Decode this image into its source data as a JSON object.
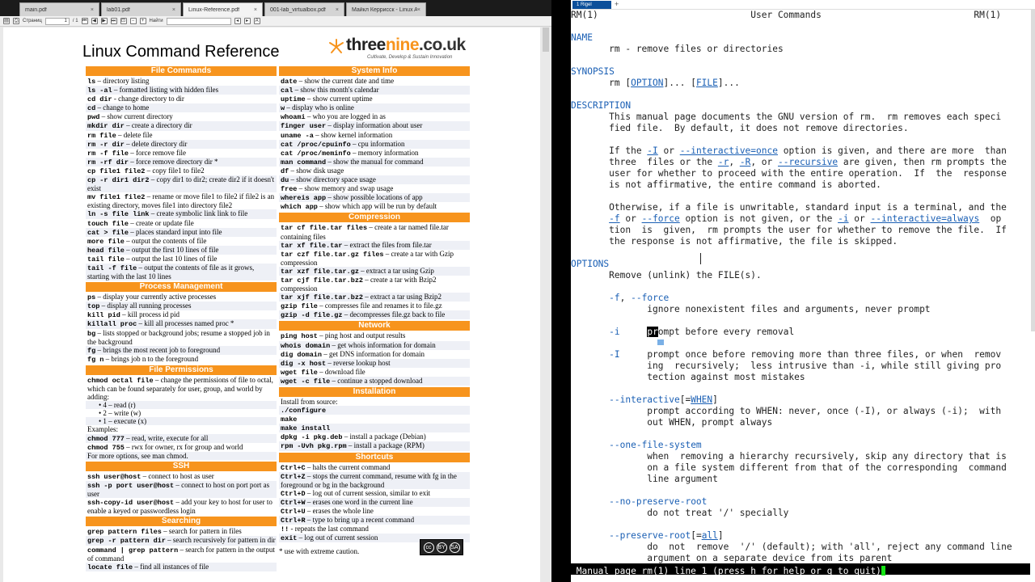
{
  "pdf_viewer": {
    "tabs": [
      {
        "label": "main.pdf",
        "active": false
      },
      {
        "label": "lab01.pdf",
        "active": false
      },
      {
        "label": "Linux-Reference.pdf",
        "active": true
      },
      {
        "label": "001-lab_virtualbox.pdf",
        "active": false
      },
      {
        "label": "Майкл Керрисск - Linux API. И...",
        "active": false
      }
    ],
    "toolbar": {
      "page_label": "Страниц",
      "page_value": "1",
      "page_total": "/ 1",
      "search_label": "Найти"
    }
  },
  "document": {
    "title": "Linux Command Reference",
    "logo": {
      "three": "three",
      "nine": "nine",
      "domain": ".co.uk",
      "tagline": "Cultivate, Develop & Sustain Innovation"
    },
    "footnote": "* use with extreme caution.",
    "cc_badge": [
      "cc",
      "BY",
      "SA"
    ],
    "left_column": [
      {
        "h": "File Commands"
      },
      {
        "c": "ls",
        "t": " – directory listing"
      },
      {
        "c": "ls -al",
        "t": " – formatted listing with hidden files"
      },
      {
        "c": "cd dir",
        "t": " - change directory to dir"
      },
      {
        "c": "cd",
        "t": " – change to home"
      },
      {
        "c": "pwd",
        "t": " – show current directory"
      },
      {
        "c": "mkdir dir",
        "t": " – create a directory dir"
      },
      {
        "c": "rm file",
        "t": " – delete file"
      },
      {
        "c": "rm -r dir",
        "t": " – delete directory dir"
      },
      {
        "c": "rm -f file",
        "t": " – force remove file"
      },
      {
        "c": "rm -rf dir",
        "t": " – force remove directory dir *"
      },
      {
        "c": "cp file1 file2",
        "t": " – copy file1 to file2"
      },
      {
        "c": "cp -r dir1 dir2",
        "t": " – copy dir1 to dir2; create dir2 if it doesn't exist"
      },
      {
        "c": "mv file1 file2",
        "t": " – rename or move file1 to file2 if file2 is an existing directory, moves file1 into directory file2"
      },
      {
        "c": "ln -s file link",
        "t": " – create symbolic link link to file"
      },
      {
        "c": "touch file",
        "t": " – create or update file"
      },
      {
        "c": "cat > file",
        "t": " – places standard input into file"
      },
      {
        "c": "more file",
        "t": " – output the contents of file"
      },
      {
        "c": "head file",
        "t": " – output the first 10 lines of file"
      },
      {
        "c": "tail file",
        "t": " – output the last 10 lines of file"
      },
      {
        "c": "tail -f file",
        "t": " – output the contents of file as it grows, starting with the last 10 lines"
      },
      {
        "h": "Process Management"
      },
      {
        "c": "ps",
        "t": " – display your currently active processes"
      },
      {
        "c": "top",
        "t": " – display all running processes"
      },
      {
        "c": "kill pid",
        "t": " – kill process id pid"
      },
      {
        "c": "killall proc",
        "t": " – kill all processes named proc *"
      },
      {
        "c": "bg",
        "t": " – lists stopped or background jobs; resume a stopped job in the background"
      },
      {
        "c": "fg",
        "t": " – brings the most recent job to foreground"
      },
      {
        "c": "fg n",
        "t": " – brings job n to the foreground"
      },
      {
        "h": "File Permissions"
      },
      {
        "c": "chmod octal file",
        "t": " – change the permissions of file to octal, which can be found separately for user, group, and world by adding:"
      },
      {
        "b": "4 – read (r)"
      },
      {
        "b": "2 – write (w)"
      },
      {
        "b": "1 – execute (x)"
      },
      {
        "c": "",
        "t": "Examples:"
      },
      {
        "c": "chmod 777",
        "t": " – read, write, execute for all"
      },
      {
        "c": "chmod 755",
        "t": " – rwx for owner, rx for group and world"
      },
      {
        "c": "",
        "t": "For more options, see man chmod."
      },
      {
        "h": "SSH"
      },
      {
        "c": "ssh user@host",
        "t": " – connect to host as user"
      },
      {
        "c": "ssh -p port user@host",
        "t": " – connect to host on port port as user"
      },
      {
        "c": "ssh-copy-id user@host",
        "t": " – add your key to host for user to enable a keyed or passwordless login"
      },
      {
        "h": "Searching"
      },
      {
        "c": "grep pattern files",
        "t": " – search for pattern in files"
      },
      {
        "c": "grep -r pattern dir",
        "t": " – search recursively for pattern in dir"
      },
      {
        "c": "command | grep pattern",
        "t": " – search for pattern in the output of command"
      },
      {
        "c": "locate file",
        "t": " – find all instances of file"
      }
    ],
    "right_column": [
      {
        "h": "System Info"
      },
      {
        "c": "date",
        "t": " – show the current date and time"
      },
      {
        "c": "cal",
        "t": " – show this month's calendar"
      },
      {
        "c": "uptime",
        "t": " – show current uptime"
      },
      {
        "c": "w",
        "t": " – display who is online"
      },
      {
        "c": "whoami",
        "t": " – who you are logged in as"
      },
      {
        "c": "finger user",
        "t": " – display information about user"
      },
      {
        "c": "uname -a",
        "t": " – show kernel information"
      },
      {
        "c": "cat /proc/cpuinfo",
        "t": " – cpu information"
      },
      {
        "c": "cat /proc/meminfo",
        "t": " – memory information"
      },
      {
        "c": "man command",
        "t": " – show the manual for command"
      },
      {
        "c": "df",
        "t": " – show disk usage"
      },
      {
        "c": "du",
        "t": " – show directory space usage"
      },
      {
        "c": "free",
        "t": " – show memory and swap usage"
      },
      {
        "c": "whereis app",
        "t": " – show possible locations of app"
      },
      {
        "c": "which app",
        "t": " – show which app will be run by default"
      },
      {
        "h": "Compression"
      },
      {
        "c": "tar cf file.tar files",
        "t": " – create a tar named file.tar containing files"
      },
      {
        "c": "tar xf file.tar",
        "t": " – extract the files from file.tar"
      },
      {
        "c": "tar czf file.tar.gz files",
        "t": " – create a tar with Gzip compression"
      },
      {
        "c": "tar xzf file.tar.gz",
        "t": " – extract a tar using Gzip"
      },
      {
        "c": "tar cjf file.tar.bz2",
        "t": " – create a tar with Bzip2 compression"
      },
      {
        "c": "tar xjf file.tar.bz2",
        "t": " – extract a tar using Bzip2"
      },
      {
        "c": "gzip file",
        "t": " – compresses file and renames it to file.gz"
      },
      {
        "c": "gzip -d file.gz",
        "t": " – decompresses file.gz back to file"
      },
      {
        "h": "Network"
      },
      {
        "c": "ping host",
        "t": " – ping host and output results"
      },
      {
        "c": "whois domain",
        "t": " – get whois information for domain"
      },
      {
        "c": "dig domain",
        "t": " – get DNS information for domain"
      },
      {
        "c": "dig -x host",
        "t": " – reverse lookup host"
      },
      {
        "c": "wget file",
        "t": " – download file"
      },
      {
        "c": "wget -c file",
        "t": " – continue a stopped download"
      },
      {
        "h": "Installation"
      },
      {
        "c": "",
        "t": "Install from source:"
      },
      {
        "c": "./configure",
        "t": ""
      },
      {
        "c": "make",
        "t": ""
      },
      {
        "c": "make install",
        "t": ""
      },
      {
        "c": "dpkg -i pkg.deb",
        "t": " – install a package (Debian)"
      },
      {
        "c": "rpm -Uvh pkg.rpm",
        "t": " – install a package (RPM)"
      },
      {
        "h": "Shortcuts"
      },
      {
        "c": "Ctrl+C",
        "t": " – halts the current command"
      },
      {
        "c": "Ctrl+Z",
        "t": " – stops the current command, resume with fg in the foreground or bg in the background"
      },
      {
        "c": "Ctrl+D",
        "t": " – log out of current session, similar to exit"
      },
      {
        "c": "Ctrl+W",
        "t": " – erases one word in the current line"
      },
      {
        "c": "Ctrl+U",
        "t": " – erases the whole line"
      },
      {
        "c": "Ctrl+R",
        "t": " – type to bring up a recent command"
      },
      {
        "c": "!!",
        "t": " - repeats the last command"
      },
      {
        "c": "exit",
        "t": " – log out of current session"
      }
    ]
  },
  "terminal": {
    "tab_label": "1 Rigel",
    "plus": "+",
    "lines": [
      {
        "html": "RM(1)                            User Commands                            RM(1)"
      },
      {
        "html": ""
      },
      {
        "html": "<span class=\"bl\">NAME</span>"
      },
      {
        "html": "       rm - remove files or directories"
      },
      {
        "html": ""
      },
      {
        "html": "<span class=\"bl\">SYNOPSIS</span>"
      },
      {
        "html": "       rm [<span class=\"blue\">OPTION</span>]... [<span class=\"blue\">FILE</span>]..."
      },
      {
        "html": ""
      },
      {
        "html": "<span class=\"bl\">DESCRIPTION</span>"
      },
      {
        "html": "       This manual page documents the GNU version of rm.  rm removes each speci"
      },
      {
        "html": "       fied file.  By default, it does not remove directories."
      },
      {
        "html": ""
      },
      {
        "html": "       If the <span class=\"blue\">-I</span> or <span class=\"blue\">--interactive=once</span> option is given, and there are more  than"
      },
      {
        "html": "       three  files or the <span class=\"blue\">-r</span>, <span class=\"blue\">-R</span>, or <span class=\"blue\">--recursive</span> are given, then rm prompts the"
      },
      {
        "html": "       user for whether to proceed with the entire operation.  If  the  response"
      },
      {
        "html": "       is not affirmative, the entire command is aborted."
      },
      {
        "html": ""
      },
      {
        "html": "       Otherwise, if a file is unwritable, standard input is a terminal, and the"
      },
      {
        "html": "       <span class=\"blue\">-f</span> or <span class=\"blue\">--force</span> option is not given, or the <span class=\"blue\">-i</span> or <span class=\"blue\">--interactive=always</span>  op"
      },
      {
        "html": "       tion  is  given,  rm prompts the user for whether to remove the file.  If"
      },
      {
        "html": "       the response is not affirmative, the file is skipped."
      },
      {
        "html": ""
      },
      {
        "html": "<span class=\"bl\">OPTIONS</span>"
      },
      {
        "html": "       Remove (unlink) the FILE(s)."
      },
      {
        "html": ""
      },
      {
        "html": "       <span class=\"bl\">-f</span>, <span class=\"bl\">--force</span>"
      },
      {
        "html": "              ignore nonexistent files and arguments, never prompt"
      },
      {
        "html": ""
      },
      {
        "html": "       <span class=\"bl\">-i</span>     <span class=\"cur\">pr</span>ompt before every removal"
      },
      {
        "html": ""
      },
      {
        "html": "       <span class=\"bl\">-I</span>     prompt once before removing more than three files, or when  remov"
      },
      {
        "html": "              ing  recursively;  less intrusive than -i, while still giving pro"
      },
      {
        "html": "              tection against most mistakes"
      },
      {
        "html": ""
      },
      {
        "html": "       <span class=\"bl\">--interactive</span>[=<span class=\"blue\">WHEN</span>]"
      },
      {
        "html": "              prompt according to WHEN: never, once (-I), or always (-i);  with"
      },
      {
        "html": "              out WHEN, prompt always"
      },
      {
        "html": ""
      },
      {
        "html": "       <span class=\"bl\">--one-file-system</span>"
      },
      {
        "html": "              when  removing a hierarchy recursively, skip any directory that is"
      },
      {
        "html": "              on a file system different from that of the corresponding  command"
      },
      {
        "html": "              line argument"
      },
      {
        "html": ""
      },
      {
        "html": "       <span class=\"bl\">--no-preserve-root</span>"
      },
      {
        "html": "              do not treat '/' specially"
      },
      {
        "html": ""
      },
      {
        "html": "       <span class=\"bl\">--preserve-root</span>[=<span class=\"blue\">all</span>]"
      },
      {
        "html": "              do  not  remove  '/' (default); with 'all', reject any command line"
      },
      {
        "html": "              argument on a separate device from its parent"
      }
    ],
    "status_line": " Manual page rm(1) line 1 (press h for help or q to quit)"
  },
  "colors": {
    "accent_orange": "#f7941d",
    "terminal_link": "#1a5fb4",
    "tab_active_blue": "#0c4f9a",
    "status_cursor": "#15e415"
  }
}
